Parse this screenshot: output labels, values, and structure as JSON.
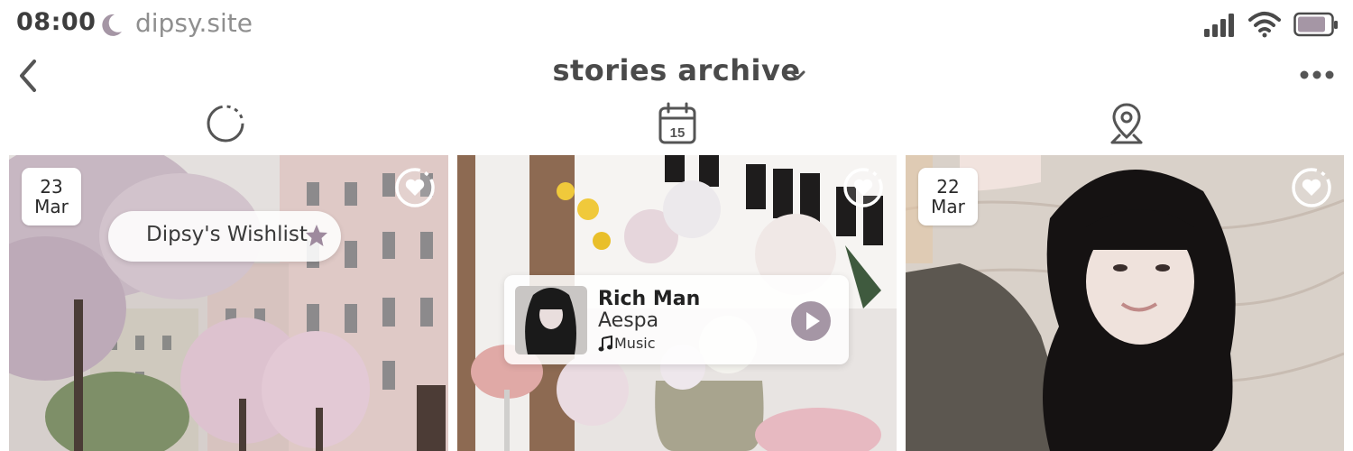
{
  "status_bar": {
    "time": "08:00",
    "url": "dipsy.site"
  },
  "header": {
    "title": "stories archive"
  },
  "tabs": [
    {
      "name": "circle-loader-icon"
    },
    {
      "name": "calendar-icon",
      "day": "15"
    },
    {
      "name": "map-pin-icon"
    }
  ],
  "stories": [
    {
      "date_day": "23",
      "date_month": "Mar",
      "wishlist_label": "Dipsy's Wishlist"
    },
    {
      "song_title": "Rich Man",
      "song_artist": "Aespa",
      "music_label": "Music"
    },
    {
      "date_day": "22",
      "date_month": "Mar"
    }
  ],
  "colors": {
    "accent": "#9e8a9e",
    "play_button": "#a596a5",
    "text": "#3a3a3a"
  }
}
